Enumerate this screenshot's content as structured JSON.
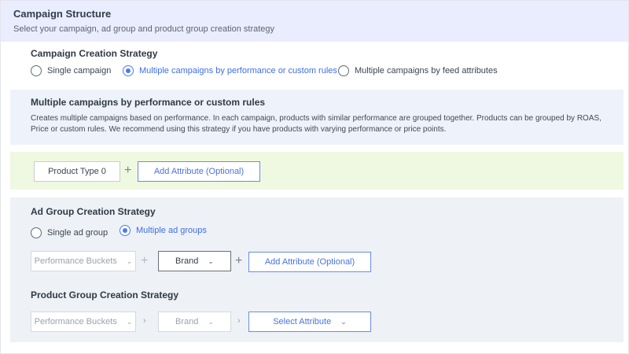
{
  "header": {
    "title": "Campaign Structure",
    "subtitle": "Select your campaign, ad group and product group creation strategy"
  },
  "campaign_strategy": {
    "label": "Campaign Creation Strategy",
    "options": [
      {
        "label": "Single campaign",
        "selected": false
      },
      {
        "label": "Multiple campaigns by performance or custom rules",
        "selected": true
      },
      {
        "label": "Multiple campaigns by feed attributes",
        "selected": false
      }
    ]
  },
  "info": {
    "title": "Multiple campaigns by performance or custom rules",
    "description": "Creates multiple campaigns based on performance. In each campaign, products with similar performance are grouped together. Products can be grouped by ROAS, Price or custom rules. We recommend using this strategy if you have products with varying performance or price points."
  },
  "campaign_attributes": {
    "product_type": "Product Type 0",
    "plus": "+",
    "add_attribute": "Add Attribute (Optional)"
  },
  "ad_group_strategy": {
    "label": "Ad Group Creation Strategy",
    "options": [
      {
        "label": "Single ad group",
        "selected": false
      },
      {
        "label": "Multiple ad groups",
        "selected": true
      }
    ],
    "performance_buckets": "Performance Buckets",
    "brand": "Brand",
    "plus": "+",
    "add_attribute": "Add Attribute (Optional)"
  },
  "product_group_strategy": {
    "label": "Product Group Creation Strategy",
    "performance_buckets": "Performance Buckets",
    "brand": "Brand",
    "separator": "›",
    "select_attribute": "Select Attribute"
  },
  "icons": {
    "chevron": "chevron-down-icon"
  },
  "colors": {
    "accent": "#4c7bf0",
    "header_bg": "#e9edfd",
    "info_bg": "#eef2fb",
    "green_band": "#eff8e0",
    "gray_panel": "#eef1f5"
  }
}
